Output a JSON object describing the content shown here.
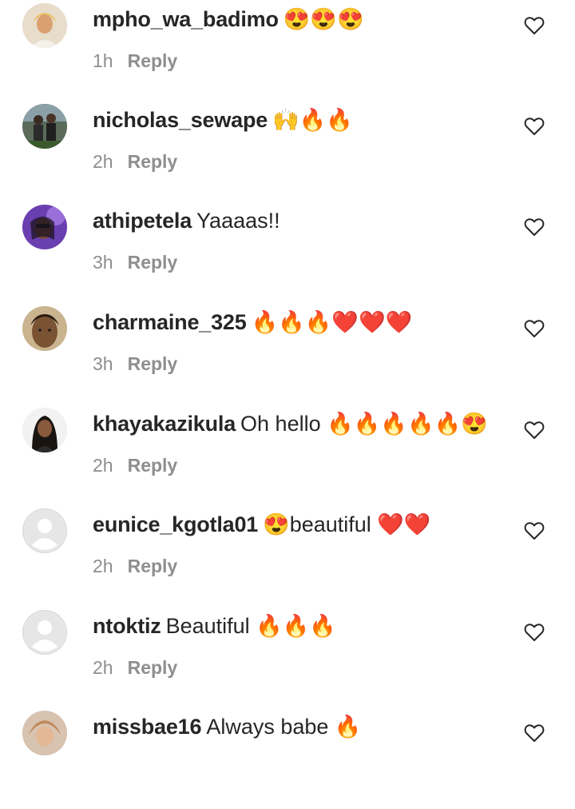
{
  "comments": [
    {
      "username": "mpho_wa_badimo",
      "text": "😍😍😍",
      "time": "1h",
      "reply_label": "Reply"
    },
    {
      "username": "nicholas_sewape",
      "text": "🙌🔥🔥",
      "time": "2h",
      "reply_label": "Reply"
    },
    {
      "username": "athipetela",
      "text": "Yaaaas!!",
      "time": "3h",
      "reply_label": "Reply"
    },
    {
      "username": "charmaine_325",
      "text": "🔥🔥🔥❤️❤️❤️",
      "time": "3h",
      "reply_label": "Reply"
    },
    {
      "username": "khayakazikula",
      "text": "Oh hello 🔥🔥🔥🔥🔥😍",
      "time": "2h",
      "reply_label": "Reply"
    },
    {
      "username": "eunice_kgotla01",
      "text": "😍beautiful ❤️❤️",
      "time": "2h",
      "reply_label": "Reply"
    },
    {
      "username": "ntoktiz",
      "text": "Beautiful 🔥🔥🔥",
      "time": "2h",
      "reply_label": "Reply"
    },
    {
      "username": "missbae16",
      "text": "Always babe 🔥",
      "time": "",
      "reply_label": ""
    }
  ],
  "colors": {
    "text": "#262626",
    "muted": "#8e8e8e",
    "heart_outline": "#262626",
    "default_avatar_bg": "#e6e6e6",
    "default_avatar_fg": "#ffffff"
  },
  "icons": {
    "like": "heart-outline-icon",
    "default_avatar": "default-profile-icon"
  }
}
